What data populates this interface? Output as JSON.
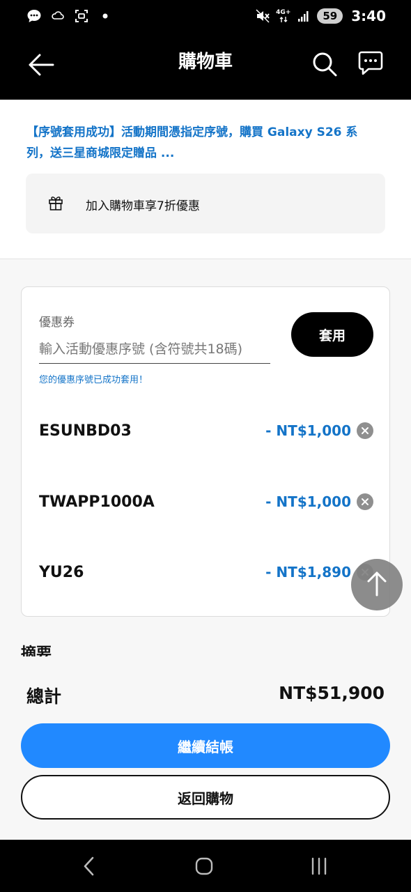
{
  "status_bar": {
    "network": "4G+",
    "battery": "59",
    "time": "3:40"
  },
  "header": {
    "title": "購物車"
  },
  "promo": {
    "link_text": "【序號套用成功】活動期間憑指定序號，購買 Galaxy S26 系列，送三星商城限定贈品 ...",
    "gift_text": "加入購物車享7折優惠"
  },
  "coupon": {
    "label": "優惠券",
    "placeholder": "輸入活動優惠序號 (含符號共18碼)",
    "apply_label": "套用",
    "success_message": "您的優惠序號已成功套用！",
    "items": [
      {
        "code": "ESUNBD03",
        "amount": "- NT$1,000"
      },
      {
        "code": "TWAPP1000A",
        "amount": "- NT$1,000"
      },
      {
        "code": "YU26",
        "amount": "- NT$1,890"
      }
    ]
  },
  "summary": {
    "title": "摘要"
  },
  "checkout": {
    "total_label": "總計",
    "total_value": "NT$51,900",
    "checkout_label": "繼續結帳",
    "back_label": "返回購物"
  },
  "colors": {
    "accent_blue": "#1474c8",
    "checkout_blue": "#2189ff",
    "header_bg": "#000000"
  }
}
